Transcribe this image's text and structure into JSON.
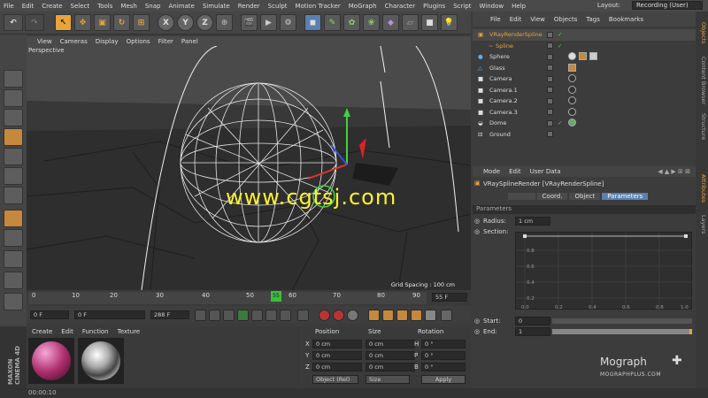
{
  "menubar": {
    "items": [
      "File",
      "Edit",
      "Create",
      "Select",
      "Tools",
      "Mesh",
      "Snap",
      "Animate",
      "Simulate",
      "Render",
      "Sculpt",
      "Motion Tracker",
      "MoGraph",
      "Character",
      "Plugins",
      "Script",
      "Window",
      "Help"
    ],
    "layout_label": "Layout:",
    "layout_value": "Recording (User)"
  },
  "toolbar": {
    "axis_labels": [
      "X",
      "Y",
      "Z"
    ]
  },
  "viewport": {
    "menu": [
      "View",
      "Cameras",
      "Display",
      "Options",
      "Filter",
      "Panel"
    ],
    "name": "Perspective",
    "grid_spacing": "Grid Spacing : 100 cm"
  },
  "timeline": {
    "ticks": [
      "0",
      "10",
      "20",
      "30",
      "40",
      "50",
      "55",
      "60",
      "70",
      "80",
      "90",
      "100"
    ],
    "current_frame": "55 F"
  },
  "transport": {
    "start": "0 F",
    "preview_start": "0 F",
    "end": "288 F"
  },
  "material_panel": {
    "menu": [
      "Create",
      "Edit",
      "Function",
      "Texture"
    ]
  },
  "coord_panel": {
    "headers": [
      "Position",
      "Size",
      "Rotation"
    ],
    "rows": [
      {
        "axis": "X",
        "pos": "0 cm",
        "size": "0 cm",
        "rot_axis": "H",
        "rot": "0 °"
      },
      {
        "axis": "Y",
        "pos": "0 cm",
        "size": "0 cm",
        "rot_axis": "P",
        "rot": "0 °"
      },
      {
        "axis": "Z",
        "pos": "0 cm",
        "size": "0 cm",
        "rot_axis": "B",
        "rot": "0 °"
      }
    ],
    "mode": "Object (Rel)",
    "size_mode": "Size",
    "apply": "Apply"
  },
  "brand": "MAXON CINEMA 4D",
  "status": "00:00:10",
  "object_manager": {
    "menu": [
      "File",
      "Edit",
      "View",
      "Objects",
      "Tags",
      "Bookmarks"
    ],
    "objects": [
      "VRayRenderSpline",
      "Spline",
      "Sphere",
      "Glass",
      "Camera",
      "Camera.1",
      "Camera.2",
      "Camera.3",
      "Dome",
      "Ground"
    ]
  },
  "attributes": {
    "menu": [
      "Mode",
      "Edit",
      "User Data"
    ],
    "title": "VRaySplineRender [VRayRenderSpline]",
    "tabs": [
      "Basic",
      "Coord.",
      "Object",
      "Parameters"
    ],
    "section": "Parameters",
    "radius_label": "Radius:",
    "radius_value": "1 cm",
    "section_label": "Section:",
    "graph_y": [
      "0.8",
      "0.6",
      "0.4",
      "0.2"
    ],
    "graph_x": [
      "0.0",
      "0.2",
      "0.4",
      "0.6",
      "0.8",
      "1.0"
    ],
    "start_label": "Start:",
    "start_value": "0",
    "end_label": "End:",
    "end_value": "1"
  },
  "side_tabs": [
    "Objects",
    "Content Browser",
    "Structure",
    "Attributes",
    "Layers"
  ],
  "mograph_logo": {
    "line1": "Mograph",
    "line2": "MOGRAPHPLUS.COM"
  },
  "watermark": "www.cgtsj.com",
  "colors": {
    "accent_orange": "#e8a33a",
    "selection_blue": "#5a7fb0",
    "watermark": "#fff12a"
  }
}
